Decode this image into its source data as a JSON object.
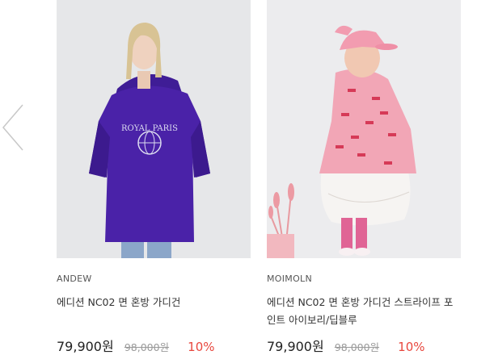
{
  "products": [
    {
      "brand": "ANDEW",
      "name": "에디션 NC02 면 혼방 가디건",
      "price": "79,900원",
      "original_price": "98,000원",
      "discount": "10%",
      "photo_text": "ROYAL PARIS"
    },
    {
      "brand": "MOIMOLN",
      "name": "에디션 NC02 면 혼방 가디건 스트라이프 포인트 아이보리/딥블루",
      "price": "79,900원",
      "original_price": "98,000원",
      "discount": "10%"
    }
  ],
  "icons": {
    "prev": "chevron-left-icon"
  },
  "colors": {
    "discount": "#e8473e",
    "sweatshirt": "#4a22a8",
    "dress": "#f2a6b6"
  }
}
